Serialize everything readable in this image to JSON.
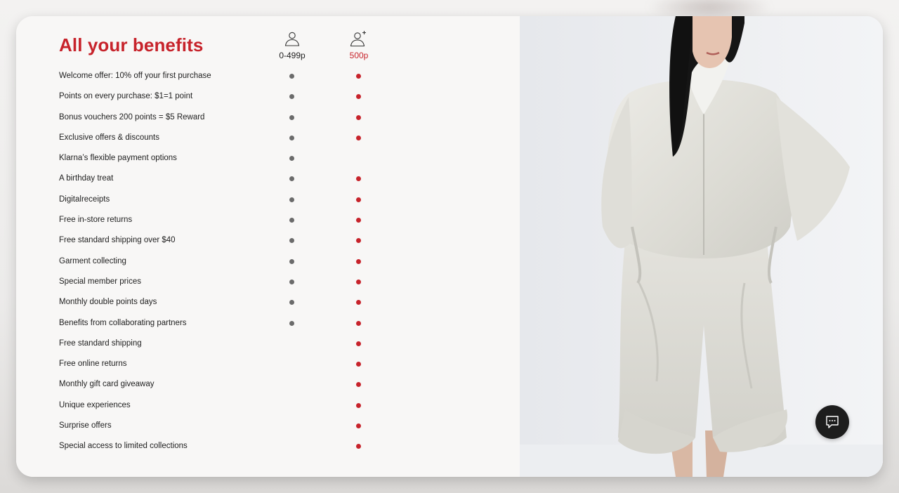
{
  "benefits_section": {
    "title": "All your benefits",
    "tiers": [
      {
        "label": "0-499p",
        "icon": "person-icon"
      },
      {
        "label": "500p",
        "icon": "person-plus-icon"
      }
    ],
    "items": [
      {
        "label": "Welcome offer: 10% off your first purchase",
        "member": true,
        "plus": true
      },
      {
        "label": "Points on every purchase: $1=1 point",
        "member": true,
        "plus": true
      },
      {
        "label": "Bonus vouchers 200 points = $5 Reward",
        "member": true,
        "plus": true
      },
      {
        "label": "Exclusive offers & discounts",
        "member": true,
        "plus": true
      },
      {
        "label": "Klarna’s flexible payment options",
        "member": true,
        "plus": false
      },
      {
        "label": "A birthday treat",
        "member": true,
        "plus": true
      },
      {
        "label": "Digitalreceipts",
        "member": true,
        "plus": true
      },
      {
        "label": "Free in-store returns",
        "member": true,
        "plus": true
      },
      {
        "label": "Free standard shipping over $40",
        "member": true,
        "plus": true
      },
      {
        "label": "Garment collecting",
        "member": true,
        "plus": true
      },
      {
        "label": "Special member prices",
        "member": true,
        "plus": true
      },
      {
        "label": "Monthly double points days",
        "member": true,
        "plus": true
      },
      {
        "label": "Benefits from collaborating partners",
        "member": true,
        "plus": true
      },
      {
        "label": "Free standard shipping",
        "member": false,
        "plus": true
      },
      {
        "label": "Free online returns",
        "member": false,
        "plus": true
      },
      {
        "label": "Monthly gift card giveaway",
        "member": false,
        "plus": true
      },
      {
        "label": "Unique experiences",
        "member": false,
        "plus": true
      },
      {
        "label": "Surprise offers",
        "member": false,
        "plus": true
      },
      {
        "label": "Special access to limited collections",
        "member": false,
        "plus": true
      }
    ]
  },
  "chat": {
    "icon": "chat-bubble-icon"
  },
  "colors": {
    "accent": "#c7232b",
    "member_dot": "#6b6b6b",
    "card_background": "#f8f7f6"
  }
}
